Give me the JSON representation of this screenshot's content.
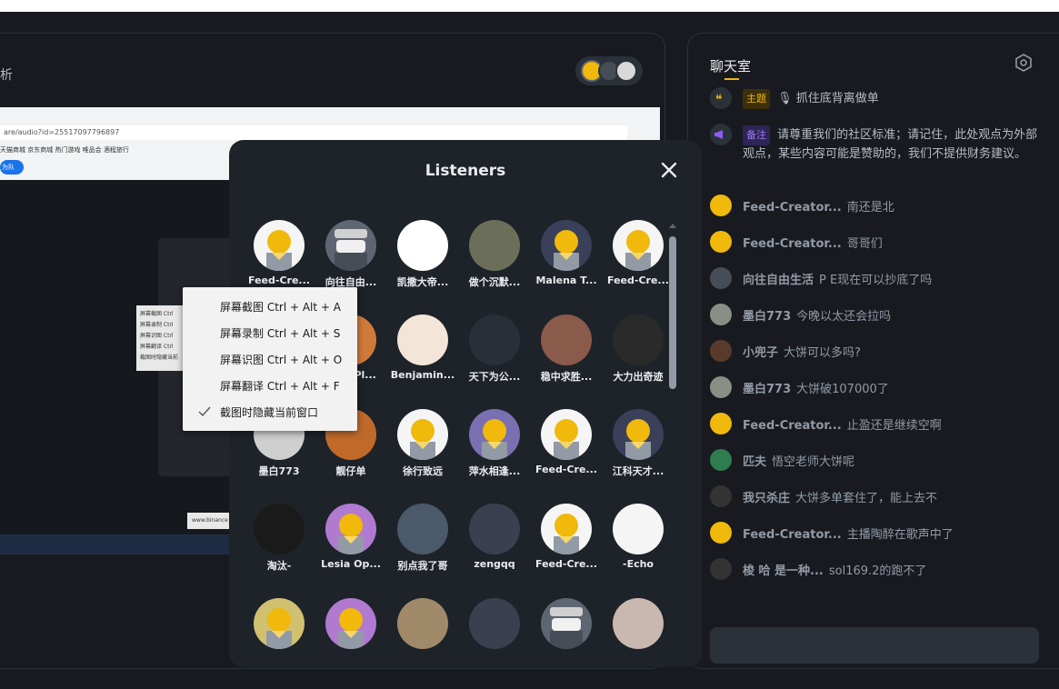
{
  "main": {
    "title_partial": "析"
  },
  "screen": {
    "url": "are/audio?id=25517097796897",
    "bookmarks": "天猫商城  京东商城  热门游戏  唯品会  酒程旅行",
    "button": "为队",
    "mini_menu": [
      "屏幕截图 Ctrl",
      "屏幕录制 Ctrl",
      "屏幕识图 Ctrl",
      "屏幕翻译 Ctrl",
      "截图时隐藏当前"
    ],
    "footer_text": "www.binance"
  },
  "chat": {
    "title": "聊天室",
    "topic_badge": "主题",
    "topic_text": "抓住底背离做单",
    "note_badge": "备注",
    "note_text": "请尊重我们的社区标准；请记住，此处观点为外部观点，某些内容可能是赞助的，我们不提供财务建议。",
    "messages": [
      {
        "user": "Feed-Creator...",
        "text": "南还是北"
      },
      {
        "user": "Feed-Creator...",
        "text": "哥哥们"
      },
      {
        "user": "向往自由生活",
        "text": "P E现在可以抄底了吗"
      },
      {
        "user": "墨白773",
        "text": "今晚以太还会拉吗"
      },
      {
        "user": "小兜子",
        "text": "大饼可以多吗?"
      },
      {
        "user": "墨白773",
        "text": "大饼破107000了"
      },
      {
        "user": "Feed-Creator...",
        "text": "止盈还是继续空啊"
      },
      {
        "user": "匹夫",
        "text": "悟空老师大饼呢"
      },
      {
        "user": "我只杀庄",
        "text": "大饼多单套住了，能上去不"
      },
      {
        "user": "Feed-Creator...",
        "text": "主播陶醉在歌声中了"
      },
      {
        "user": "梭 哈 是一种...",
        "text": "sol169.2的跑不了"
      }
    ]
  },
  "modal": {
    "title": "Listeners",
    "listeners": [
      {
        "name": "Feed-Cre...",
        "avatar": "default"
      },
      {
        "name": "向往自由...",
        "avatar": "bandit"
      },
      {
        "name": "凯撒大帝...",
        "avatar": "batman"
      },
      {
        "name": "做个沉默...",
        "avatar": "photo-road"
      },
      {
        "name": "Malena T...",
        "avatar": "hat"
      },
      {
        "name": "Feed-Cre...",
        "avatar": "default"
      },
      {
        "name": "",
        "avatar": "hidden"
      },
      {
        "name": "...ee Pl...",
        "avatar": "fox"
      },
      {
        "name": "Benjamin...",
        "avatar": "baby"
      },
      {
        "name": "天下为公...",
        "avatar": "photo-night"
      },
      {
        "name": "稳中求胜...",
        "avatar": "photo-art"
      },
      {
        "name": "大力出奇迹",
        "avatar": "photo-muscle"
      },
      {
        "name": "墨白773",
        "avatar": "photo-dog"
      },
      {
        "name": "靓仔单",
        "avatar": "photo-sunset"
      },
      {
        "name": "徐行致远",
        "avatar": "default"
      },
      {
        "name": "萍水相逢...",
        "avatar": "glasses"
      },
      {
        "name": "Feed-Cre...",
        "avatar": "default"
      },
      {
        "name": "江科天才...",
        "avatar": "hat"
      },
      {
        "name": "淘汰-",
        "avatar": "photo-dance"
      },
      {
        "name": "Lesia Op...",
        "avatar": "party"
      },
      {
        "name": "别点我了哥",
        "avatar": "photo-anime"
      },
      {
        "name": "zengqq",
        "avatar": "cap"
      },
      {
        "name": "Feed-Cre...",
        "avatar": "default"
      },
      {
        "name": "-Echo",
        "avatar": "photo-conan"
      },
      {
        "name": "",
        "avatar": "crown"
      },
      {
        "name": "",
        "avatar": "party"
      },
      {
        "name": "",
        "avatar": "photo-room"
      },
      {
        "name": "",
        "avatar": "grad"
      },
      {
        "name": "",
        "avatar": "bandit"
      },
      {
        "name": "",
        "avatar": "photo-girl"
      }
    ]
  },
  "context_menu": {
    "items": [
      "屏幕截图 Ctrl + Alt + A",
      "屏幕录制 Ctrl + Alt + S",
      "屏幕识图 Ctrl + Alt + O",
      "屏幕翻译 Ctrl + Alt + F",
      "截图时隐藏当前窗口"
    ]
  },
  "colors": {
    "accent": "#f0b90b",
    "panel": "#1e2329",
    "bg": "#181a20",
    "note": "#6c3bd1"
  }
}
